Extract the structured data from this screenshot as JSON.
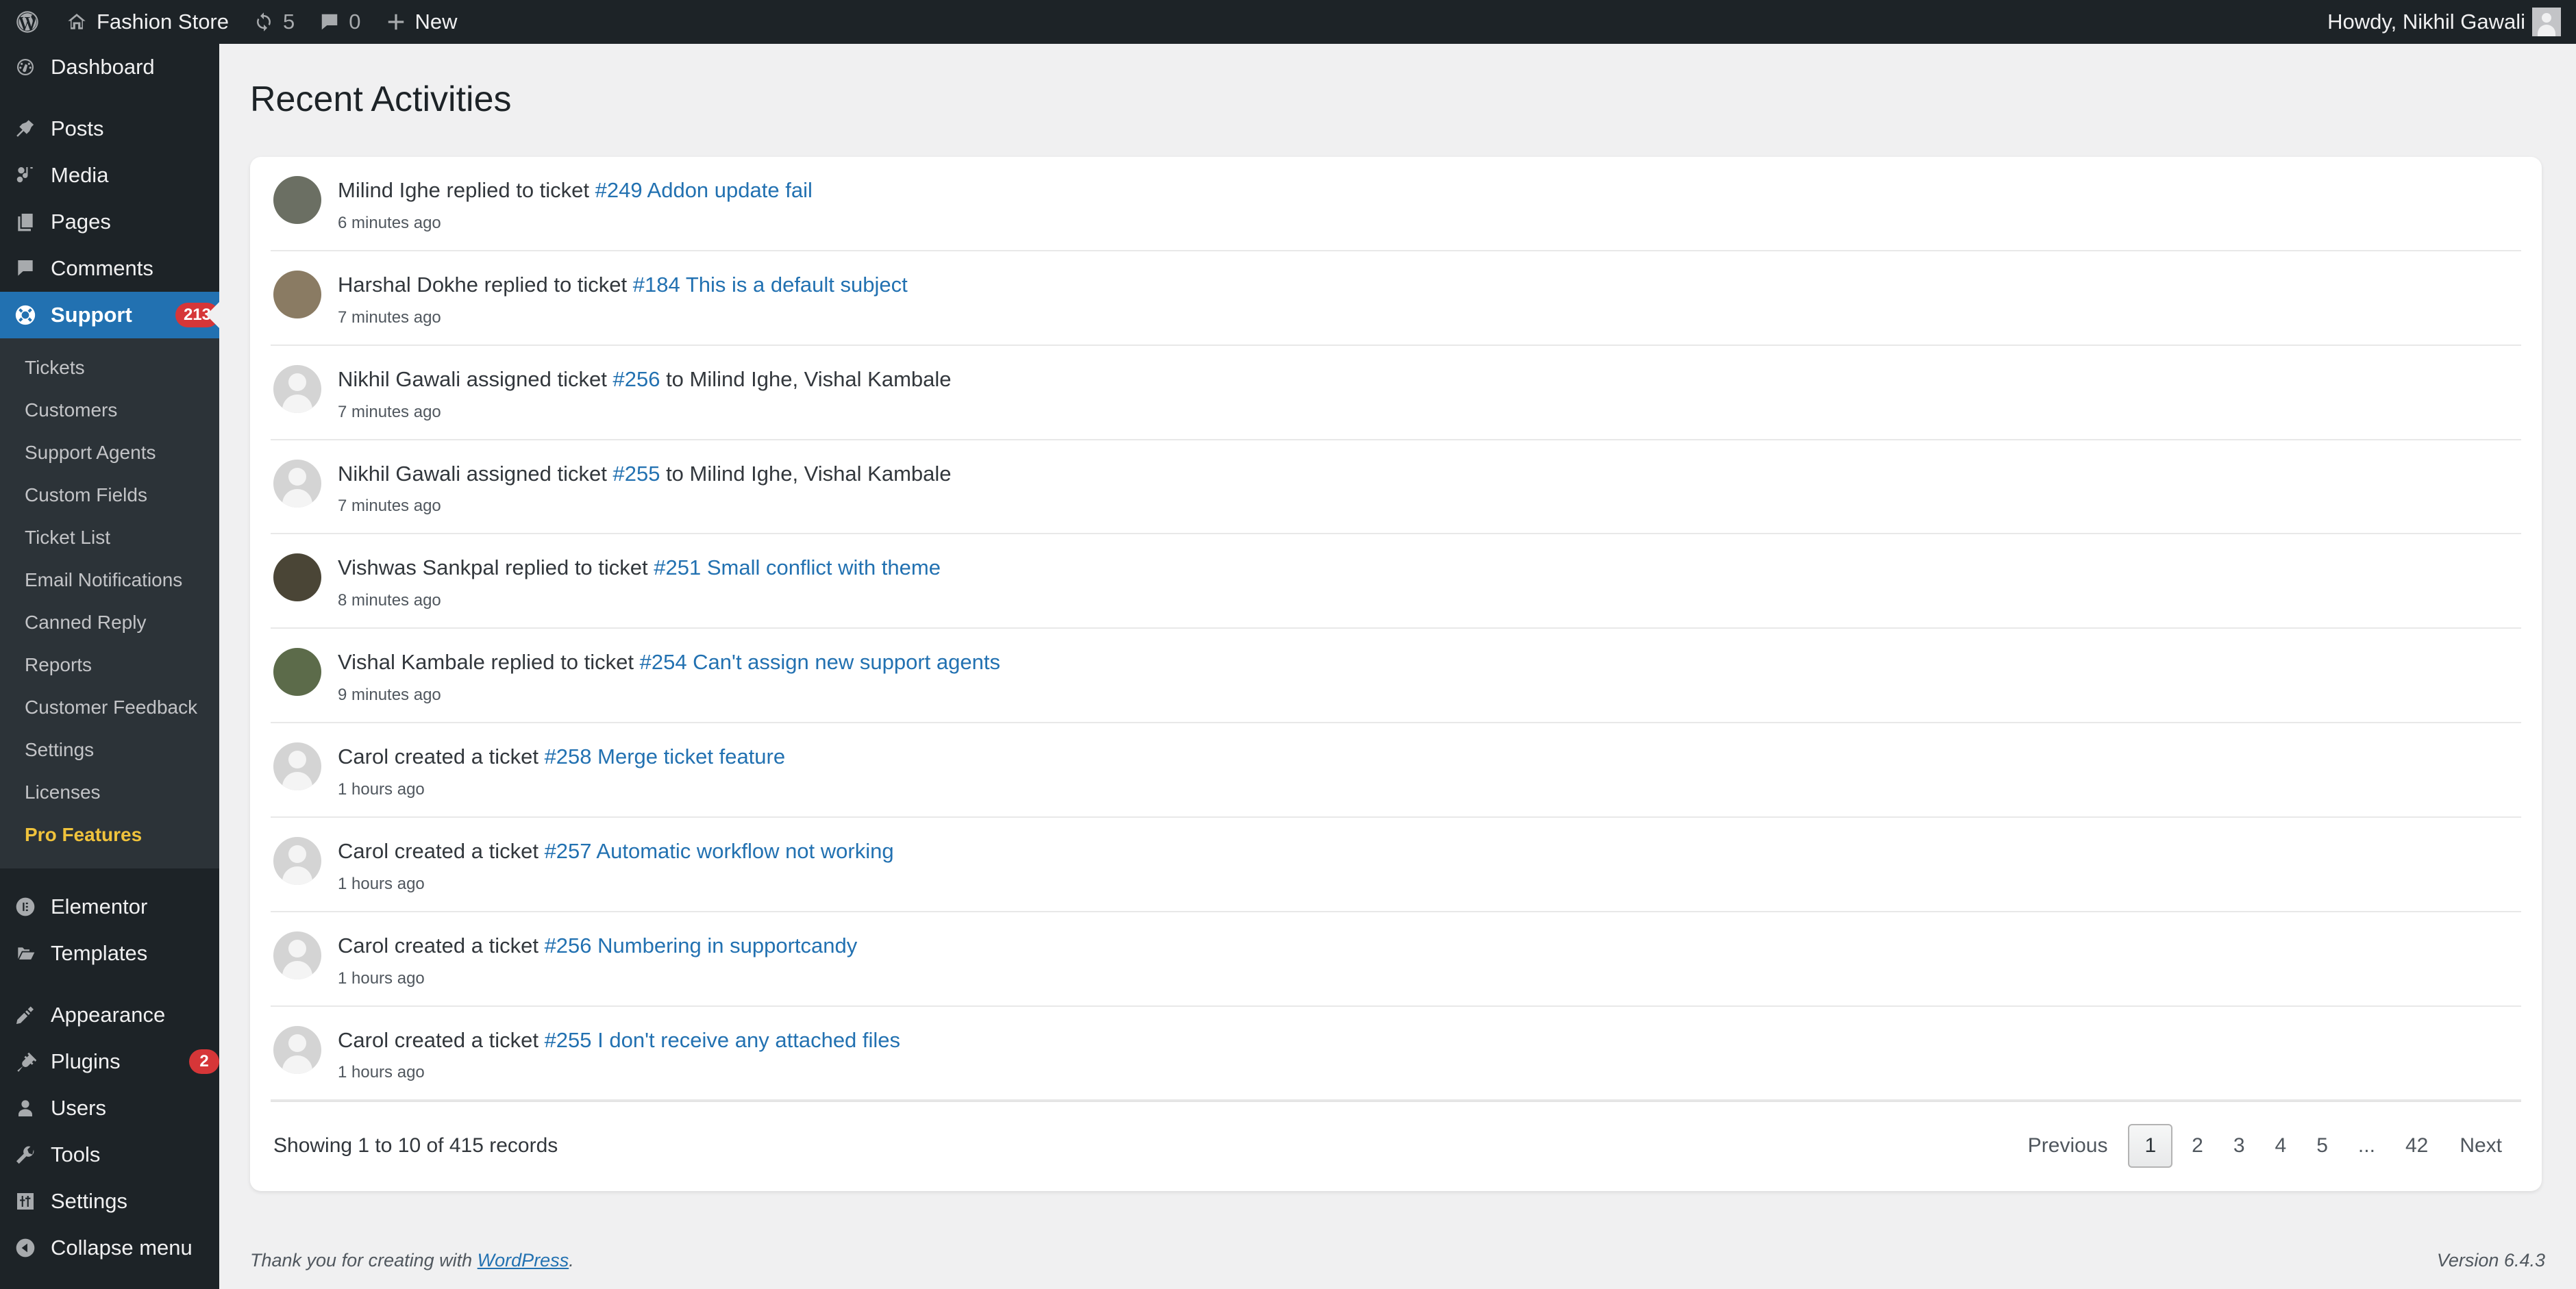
{
  "adminbar": {
    "logo_icon": "wordpress-logo-icon",
    "site_icon": "home-icon",
    "site_name": "Fashion Store",
    "updates_icon": "updates-icon",
    "updates_count": "5",
    "comments_icon": "comment-bubble-icon",
    "comments_count": "0",
    "new_icon": "plus-icon",
    "new_label": "New",
    "howdy": "Howdy, Nikhil Gawali",
    "avatar_icon": "user-avatar-icon"
  },
  "sidebar": {
    "items": [
      {
        "label": "Dashboard",
        "icon": "dashboard-icon",
        "name": "dashboard",
        "current": false,
        "gap_after": true
      },
      {
        "label": "Posts",
        "icon": "pin-icon",
        "name": "posts",
        "current": false
      },
      {
        "label": "Media",
        "icon": "media-icon",
        "name": "media",
        "current": false
      },
      {
        "label": "Pages",
        "icon": "pages-icon",
        "name": "pages",
        "current": false
      },
      {
        "label": "Comments",
        "icon": "comments-icon",
        "name": "comments",
        "current": false
      },
      {
        "label": "Support",
        "icon": "support-lifebuoy-icon",
        "name": "support",
        "current": true,
        "badge": "213"
      }
    ],
    "submenu": [
      {
        "label": "Tickets",
        "name": "tickets"
      },
      {
        "label": "Customers",
        "name": "customers"
      },
      {
        "label": "Support Agents",
        "name": "support-agents"
      },
      {
        "label": "Custom Fields",
        "name": "custom-fields"
      },
      {
        "label": "Ticket List",
        "name": "ticket-list"
      },
      {
        "label": "Email Notifications",
        "name": "email-notifications"
      },
      {
        "label": "Canned Reply",
        "name": "canned-reply"
      },
      {
        "label": "Reports",
        "name": "reports"
      },
      {
        "label": "Customer Feedback",
        "name": "customer-feedback"
      },
      {
        "label": "Settings",
        "name": "settings"
      },
      {
        "label": "Licenses",
        "name": "licenses"
      },
      {
        "label": "Pro Features",
        "name": "pro-features",
        "pro": true
      }
    ],
    "items_lower": [
      {
        "label": "Elementor",
        "icon": "elementor-icon",
        "name": "elementor"
      },
      {
        "label": "Templates",
        "icon": "folder-icon",
        "name": "templates",
        "gap_after": true
      },
      {
        "label": "Appearance",
        "icon": "brush-icon",
        "name": "appearance"
      },
      {
        "label": "Plugins",
        "icon": "plug-icon",
        "name": "plugins",
        "badge": "2"
      },
      {
        "label": "Users",
        "icon": "user-icon",
        "name": "users"
      },
      {
        "label": "Tools",
        "icon": "wrench-icon",
        "name": "tools"
      },
      {
        "label": "Settings",
        "icon": "sliders-icon",
        "name": "settings"
      },
      {
        "label": "Collapse menu",
        "icon": "collapse-arrow-icon",
        "name": "collapse-menu"
      }
    ]
  },
  "main": {
    "title": "Recent Activities",
    "activities": [
      {
        "actor": "Milind Ighe",
        "verb": "replied to ticket",
        "link": "#249 Addon update fail",
        "suffix": "",
        "time": "6 minutes ago",
        "avatar": "photo",
        "avatar_color": "#6b6f63"
      },
      {
        "actor": "Harshal Dokhe",
        "verb": "replied to ticket",
        "link": "#184 This is a default subject",
        "suffix": "",
        "time": "7 minutes ago",
        "avatar": "photo",
        "avatar_color": "#8a7b63"
      },
      {
        "actor": "Nikhil Gawali",
        "verb": "assigned ticket",
        "link": "#256",
        "suffix": " to Milind Ighe, Vishal Kambale",
        "time": "7 minutes ago",
        "avatar": "placeholder"
      },
      {
        "actor": "Nikhil Gawali",
        "verb": "assigned ticket",
        "link": "#255",
        "suffix": " to Milind Ighe, Vishal Kambale",
        "time": "7 minutes ago",
        "avatar": "placeholder"
      },
      {
        "actor": "Vishwas Sankpal",
        "verb": "replied to ticket",
        "link": "#251 Small conflict with theme",
        "suffix": "",
        "time": "8 minutes ago",
        "avatar": "photo",
        "avatar_color": "#4a4536"
      },
      {
        "actor": "Vishal Kambale",
        "verb": "replied to ticket",
        "link": "#254 Can't assign new support agents",
        "suffix": "",
        "time": "9 minutes ago",
        "avatar": "photo",
        "avatar_color": "#5c6b4a"
      },
      {
        "actor": "Carol",
        "verb": "created a ticket",
        "link": "#258 Merge ticket feature",
        "suffix": "",
        "time": "1 hours ago",
        "avatar": "placeholder"
      },
      {
        "actor": "Carol",
        "verb": "created a ticket",
        "link": "#257 Automatic workflow not working",
        "suffix": "",
        "time": "1 hours ago",
        "avatar": "placeholder"
      },
      {
        "actor": "Carol",
        "verb": "created a ticket",
        "link": "#256 Numbering in supportcandy",
        "suffix": "",
        "time": "1 hours ago",
        "avatar": "placeholder"
      },
      {
        "actor": "Carol",
        "verb": "created a ticket",
        "link": "#255 I don't receive any attached files",
        "suffix": "",
        "time": "1 hours ago",
        "avatar": "placeholder"
      }
    ],
    "records_label": "Showing 1 to 10 of 415 records",
    "pagination": {
      "previous": "Previous",
      "pages": [
        "1",
        "2",
        "3",
        "4",
        "5",
        "...",
        "42"
      ],
      "active": "1",
      "next": "Next"
    }
  },
  "footer": {
    "thanks_prefix": "Thank you for creating with ",
    "wordpress_link": "WordPress",
    "thanks_suffix": ".",
    "version": "Version 6.4.3"
  },
  "colors": {
    "link": "#2271b1",
    "current_menu": "#2271b1",
    "badge": "#d63638",
    "pro": "#f0c33c",
    "sidebar": "#1d2327",
    "submenu": "#2c3338",
    "page_bg": "#f0f0f1"
  }
}
